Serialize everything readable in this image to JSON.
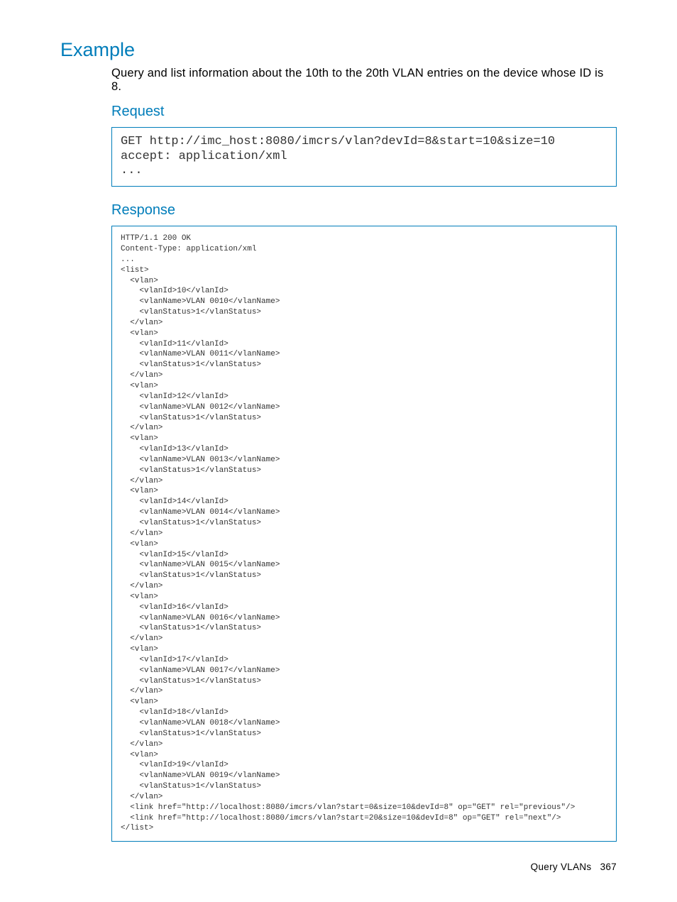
{
  "headings": {
    "example": "Example",
    "request": "Request",
    "response": "Response"
  },
  "intro": "Query and list information about the 10th to the 20th VLAN entries on the device whose ID is 8.",
  "request_block": "GET http://imc_host:8080/imcrs/vlan?devId=8&start=10&size=10\naccept: application/xml\n...",
  "response_block": "HTTP/1.1 200 OK\nContent-Type: application/xml\n...\n<list>\n  <vlan>\n    <vlanId>10</vlanId>\n    <vlanName>VLAN 0010</vlanName>\n    <vlanStatus>1</vlanStatus>\n  </vlan>\n  <vlan>\n    <vlanId>11</vlanId>\n    <vlanName>VLAN 0011</vlanName>\n    <vlanStatus>1</vlanStatus>\n  </vlan>\n  <vlan>\n    <vlanId>12</vlanId>\n    <vlanName>VLAN 0012</vlanName>\n    <vlanStatus>1</vlanStatus>\n  </vlan>\n  <vlan>\n    <vlanId>13</vlanId>\n    <vlanName>VLAN 0013</vlanName>\n    <vlanStatus>1</vlanStatus>\n  </vlan>\n  <vlan>\n    <vlanId>14</vlanId>\n    <vlanName>VLAN 0014</vlanName>\n    <vlanStatus>1</vlanStatus>\n  </vlan>\n  <vlan>\n    <vlanId>15</vlanId>\n    <vlanName>VLAN 0015</vlanName>\n    <vlanStatus>1</vlanStatus>\n  </vlan>\n  <vlan>\n    <vlanId>16</vlanId>\n    <vlanName>VLAN 0016</vlanName>\n    <vlanStatus>1</vlanStatus>\n  </vlan>\n  <vlan>\n    <vlanId>17</vlanId>\n    <vlanName>VLAN 0017</vlanName>\n    <vlanStatus>1</vlanStatus>\n  </vlan>\n  <vlan>\n    <vlanId>18</vlanId>\n    <vlanName>VLAN 0018</vlanName>\n    <vlanStatus>1</vlanStatus>\n  </vlan>\n  <vlan>\n    <vlanId>19</vlanId>\n    <vlanName>VLAN 0019</vlanName>\n    <vlanStatus>1</vlanStatus>\n  </vlan>\n  <link href=\"http://localhost:8080/imcrs/vlan?start=0&size=10&devId=8\" op=\"GET\" rel=\"previous\"/>\n  <link href=\"http://localhost:8080/imcrs/vlan?start=20&size=10&devId=8\" op=\"GET\" rel=\"next\"/>\n</list>",
  "footer": {
    "title": "Query VLANs",
    "page": "367"
  }
}
